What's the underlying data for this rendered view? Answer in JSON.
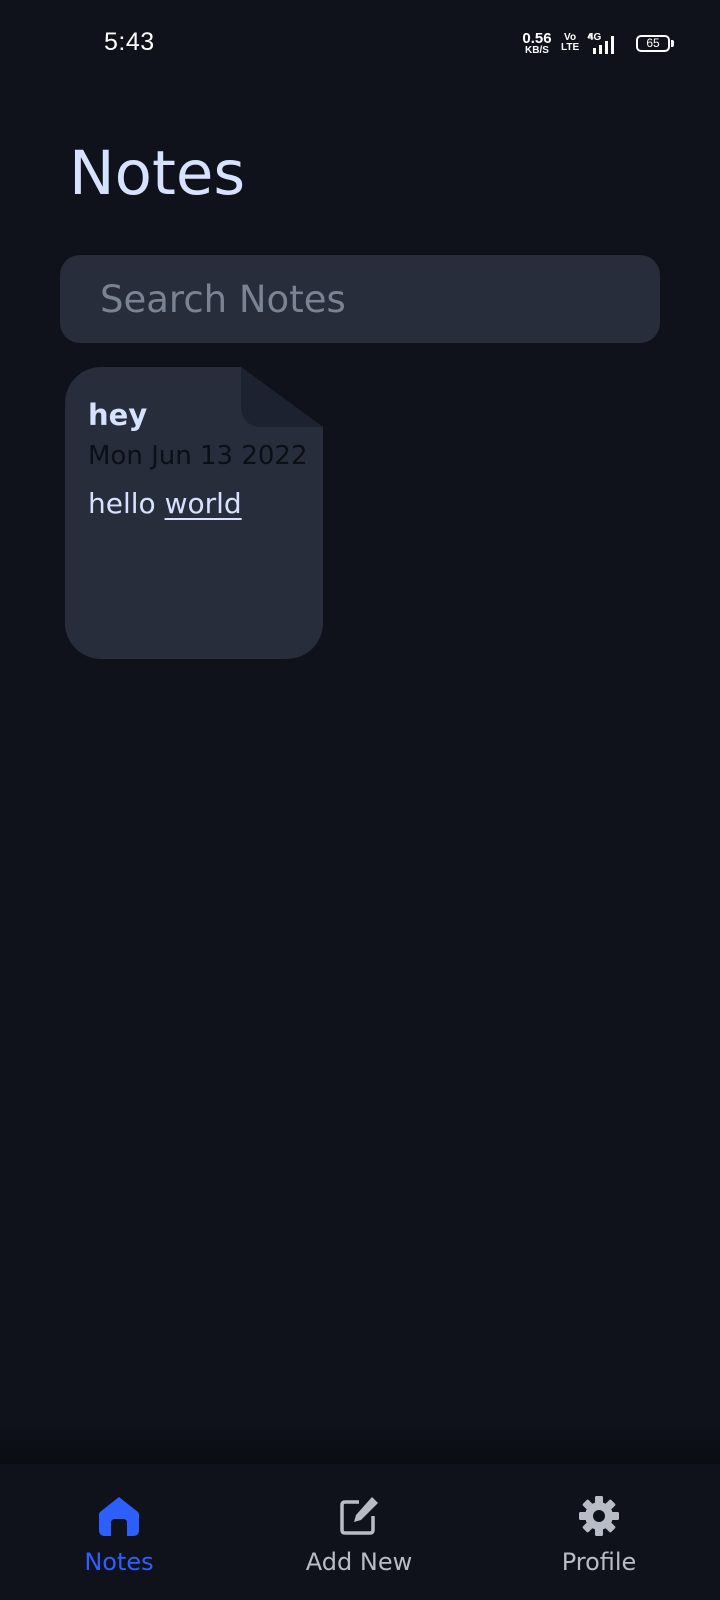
{
  "status_bar": {
    "time": "5:43",
    "net_speed_value": "0.56",
    "net_speed_unit": "KB/S",
    "volte_top": "Vo",
    "volte_bottom": "LTE",
    "network_type": "4G",
    "battery_level": "65"
  },
  "header": {
    "title": "Notes"
  },
  "search": {
    "placeholder": "Search Notes",
    "value": ""
  },
  "notes": [
    {
      "title": "hey",
      "date": "Mon Jun 13 2022",
      "body_plain": "hello ",
      "body_underlined": "world"
    }
  ],
  "bottom_nav": {
    "items": [
      {
        "label": "Notes",
        "icon": "home-icon",
        "active": true
      },
      {
        "label": "Add New",
        "icon": "edit-icon",
        "active": false
      },
      {
        "label": "Profile",
        "icon": "gear-icon",
        "active": false
      }
    ]
  },
  "colors": {
    "background": "#0f121a",
    "surface": "#272d3b",
    "text_primary": "#d6e2ff",
    "accent": "#2d5fff",
    "nav_inactive": "#b8bcc6",
    "placeholder": "#7a8393"
  }
}
